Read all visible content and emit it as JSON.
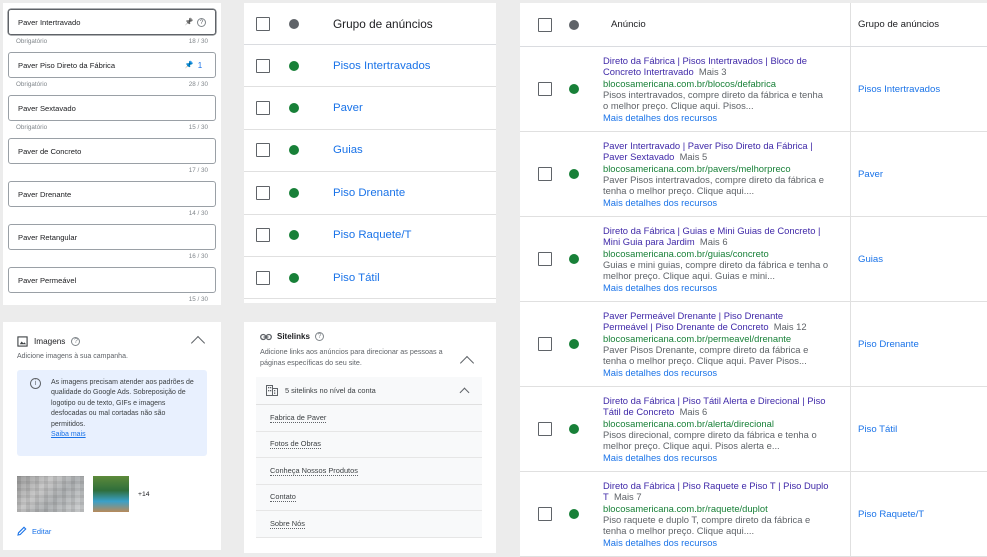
{
  "headlines": [
    {
      "text": "Paver Intertravado",
      "meta_left": "Obrigatório",
      "count": "18 / 30",
      "pin": "pinned",
      "extra": "?",
      "active": true
    },
    {
      "text": "Paver Piso Direto da Fábrica",
      "meta_left": "Obrigatório",
      "count": "28 / 30",
      "pin": "pinned-blue",
      "extra": "1",
      "active": false
    },
    {
      "text": "Paver Sextavado",
      "meta_left": "Obrigatório",
      "count": "15 / 30",
      "pin": "",
      "extra": "",
      "active": false
    },
    {
      "text": "Paver de Concreto",
      "meta_left": "",
      "count": "17 / 30",
      "pin": "",
      "extra": "",
      "active": false
    },
    {
      "text": "Paver Drenante",
      "meta_left": "",
      "count": "14 / 30",
      "pin": "",
      "extra": "",
      "active": false
    },
    {
      "text": "Paver Retangular",
      "meta_left": "",
      "count": "16 / 30",
      "pin": "",
      "extra": "",
      "active": false
    },
    {
      "text": "Paver Permeável",
      "meta_left": "",
      "count": "15 / 30",
      "pin": "",
      "extra": "",
      "active": false
    }
  ],
  "images": {
    "title": "Imagens",
    "subtitle": "Adicione imagens à sua campanha.",
    "info": "As imagens precisam atender aos padrões de qualidade do Google Ads. Sobreposição de logotipo ou de texto, GIFs e imagens desfocadas ou mal cortadas não são permitidos.",
    "info_link": "Saiba mais",
    "more_count": "+14",
    "edit_label": "Editar"
  },
  "groups": {
    "header": "Grupo de anúncios",
    "rows": [
      "Pisos Intertravados",
      "Paver",
      "Guias",
      "Piso Drenante",
      "Piso Raquete/T",
      "Piso Tátil"
    ],
    "status_color": "#188038",
    "header_dot_color": "#5f6368"
  },
  "sitelinks": {
    "title": "Sitelinks",
    "subtitle": "Adicione links aos anúncios para direcionar as pessoas a páginas específicas do seu site.",
    "box_title": "5 sitelinks no nível da conta",
    "items": [
      "Fabrica de Paver",
      "Fotos de Obras",
      "Conheça Nossos Produtos",
      "Contato",
      "Sobre Nós"
    ]
  },
  "ads": {
    "col_ad": "Anúncio",
    "col_group": "Grupo de anúncios",
    "rows": [
      {
        "headline": "Direto da Fábrica | Pisos Intertravados | Bloco de Concreto Intertravado",
        "more": "Mais 3",
        "url": "blocosamericana.com.br/blocos/defabrica",
        "desc": "Pisos intertravados, compre direto da fábrica e tenha o melhor preço. Clique aqui. Pisos...",
        "details": "Mais detalhes dos recursos",
        "group": "Pisos Intertravados"
      },
      {
        "headline": "Paver Intertravado | Paver Piso Direto da Fábrica | Paver Sextavado",
        "more": "Mais 5",
        "url": "blocosamericana.com.br/pavers/melhorpreco",
        "desc": "Paver Pisos intertravados, compre direto da fábrica e tenha o melhor preço. Clique aqui....",
        "details": "Mais detalhes dos recursos",
        "group": "Paver"
      },
      {
        "headline": "Direto da Fábrica | Guias e Mini Guias de Concreto | Mini Guia para Jardim",
        "more": "Mais 6",
        "url": "blocosamericana.com.br/guias/concreto",
        "desc": "Guias e mini guias, compre direto da fábrica e tenha o melhor preço. Clique aqui. Guias e mini...",
        "details": "Mais detalhes dos recursos",
        "group": "Guias"
      },
      {
        "headline": "Paver Permeável Drenante | Piso Drenante Permeável | Piso Drenante de Concreto",
        "more": "Mais 12",
        "url": "blocosamericana.com.br/permeavel/drenante",
        "desc": "Paver Pisos Drenante, compre direto da fábrica e tenha o melhor preço. Clique aqui. Paver Pisos...",
        "details": "Mais detalhes dos recursos",
        "group": "Piso Drenante"
      },
      {
        "headline": "Direto da Fábrica | Piso Tátil Alerta e Direcional | Piso Tátil de Concreto",
        "more": "Mais 6",
        "url": "blocosamericana.com.br/alerta/direcional",
        "desc": "Pisos direcional, compre direto da fábrica e tenha o melhor preço. Clique aqui. Pisos alerta e...",
        "details": "Mais detalhes dos recursos",
        "group": "Piso Tátil"
      },
      {
        "headline": "Direto da Fábrica | Piso Raquete e Piso T | Piso Duplo T",
        "more": "Mais 7",
        "url": "blocosamericana.com.br/raquete/duplot",
        "desc": "Piso raquete e duplo T, compre direto da fábrica e tenha o melhor preço. Clique aqui....",
        "details": "Mais detalhes dos recursos",
        "group": "Piso Raquete/T"
      }
    ]
  }
}
